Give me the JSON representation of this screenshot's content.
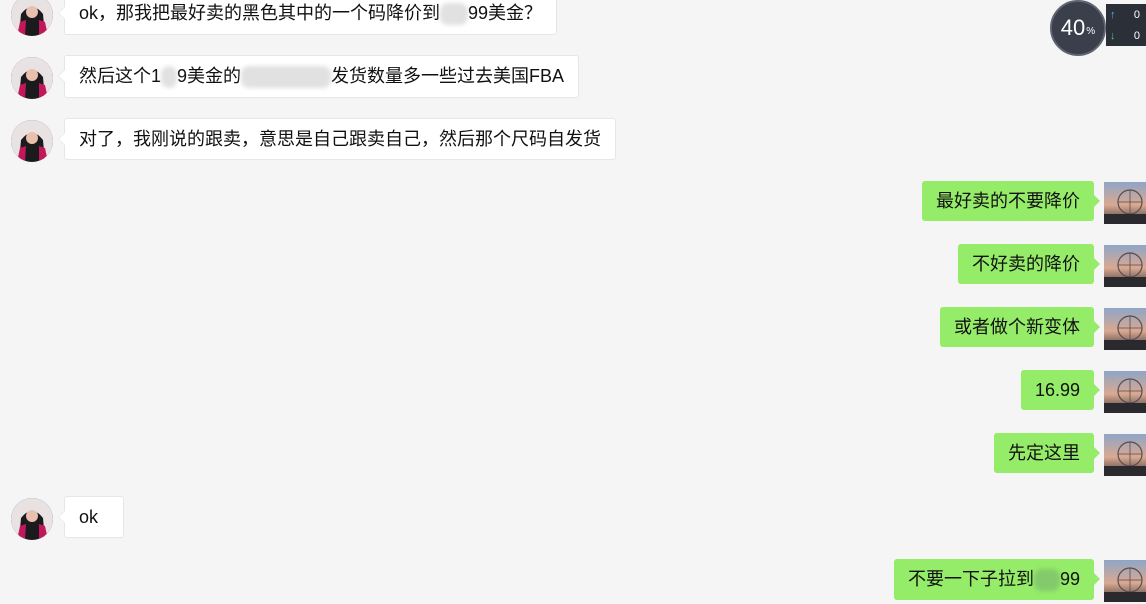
{
  "widget": {
    "percent": "40",
    "unit": "%",
    "upload": "0",
    "download": "0"
  },
  "messages": [
    {
      "side": "other",
      "text_a": "ok，那我把最好卖的黑色其中的一个码降价到",
      "text_b": "99美金？"
    },
    {
      "side": "other",
      "text_a": "然后这个1",
      "text_b": "9美金的",
      "text_c": "发货数量多一些过去美国FBA"
    },
    {
      "side": "other",
      "text": "对了，我刚说的跟卖，意思是自己跟卖自己，然后那个尺码自发货"
    },
    {
      "side": "mine",
      "text": "最好卖的不要降价"
    },
    {
      "side": "mine",
      "text": "不好卖的降价"
    },
    {
      "side": "mine",
      "text": "或者做个新变体"
    },
    {
      "side": "mine",
      "text": "16.99"
    },
    {
      "side": "mine",
      "text": "先定这里"
    },
    {
      "side": "other",
      "text": "ok"
    },
    {
      "side": "mine",
      "text_a": "不要一下子拉到",
      "text_b": "99"
    }
  ]
}
